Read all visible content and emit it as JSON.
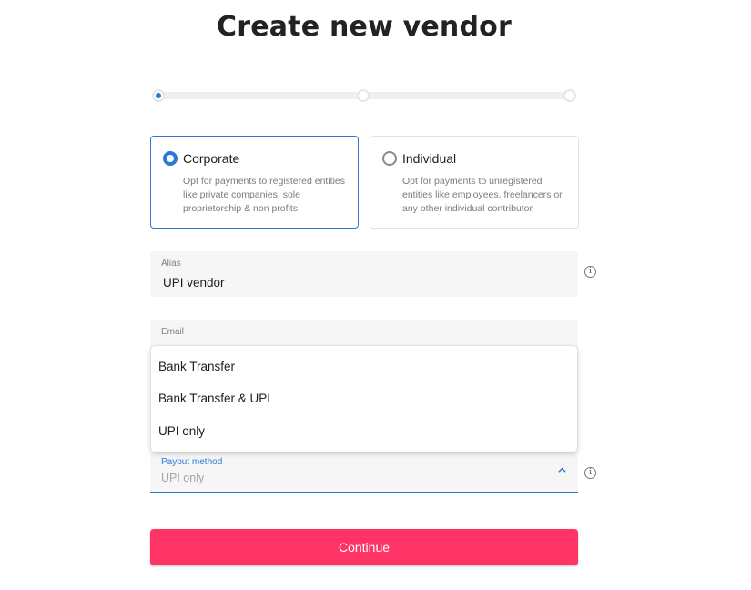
{
  "page": {
    "title": "Create new vendor"
  },
  "stepper": {
    "steps": 3,
    "current": 1
  },
  "entity_types": [
    {
      "label": "Corporate",
      "selected": true,
      "description": "Opt for payments to registered entities like private companies, sole proprietorship & non profits"
    },
    {
      "label": "Individual",
      "selected": false,
      "description": "Opt for payments to unregistered entities like employees, freelancers or any other individual contributor"
    }
  ],
  "fields": {
    "alias": {
      "label": "Alias",
      "value": "UPI vendor"
    },
    "email": {
      "label": "Email",
      "value": ""
    },
    "payout_method": {
      "label": "Payout method",
      "value": "UPI only"
    }
  },
  "dropdown": {
    "options": [
      "Bank Transfer",
      "Bank Transfer & UPI",
      "UPI only"
    ]
  },
  "actions": {
    "continue_label": "Continue"
  },
  "info_icon_glyph": "i",
  "colors": {
    "accent": "#2b78d6",
    "primary_button": "#ff3366"
  }
}
